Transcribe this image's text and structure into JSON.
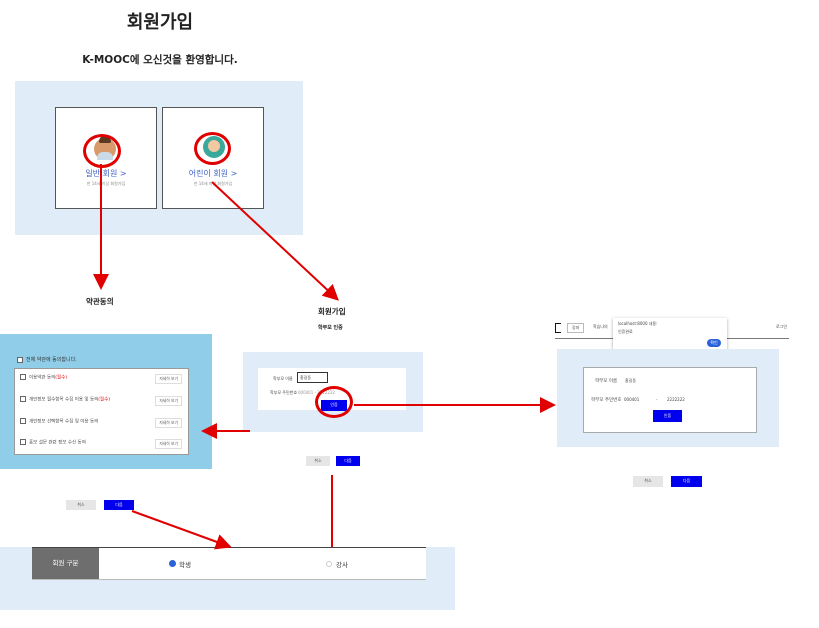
{
  "title": "회원가입",
  "welcome": "K-MOOC에 오신것을 환영합니다.",
  "cards": {
    "general": {
      "label": "일반 회원 >",
      "sub": "만 14세 이상 회원가입"
    },
    "child": {
      "label": "어린이 회원 >",
      "sub": "만 14세 미만 회원가입"
    }
  },
  "terms_heading": "약관동의",
  "terms": {
    "all": "전체 약관에 동의합니다.",
    "items": [
      {
        "text": "이용약관 동의",
        "req": "(필수)",
        "detail": "자세히 보기"
      },
      {
        "text": "개인정보 필수항목 수집 이용 및 동의",
        "req": "(필수)",
        "detail": "자세히 보기"
      },
      {
        "text": "개인정보 선택항목 수집 및 이용 동의",
        "req": "",
        "detail": "자세히 보기"
      },
      {
        "text": "홍보 설문 관련 정보 수신 동의",
        "req": "",
        "detail": "자세히 보기"
      }
    ]
  },
  "signup2": {
    "title": "회원가입",
    "subtitle": "학부모 인증"
  },
  "auth_form": {
    "name_label": "학부모 이름",
    "name_value": "홍길동",
    "rrn_label": "학부모 주민번호",
    "rrn_value": "000401  -  2222222",
    "verify": "인증"
  },
  "buttons": {
    "cancel": "취소",
    "next": "다음"
  },
  "screenshot": {
    "nav_items": [
      "강좌",
      "학습나의"
    ],
    "popup_title": "localhost:8000 내용:",
    "popup_msg": "인증완료",
    "popup_ok": "확인",
    "login": "로그인",
    "name_label": "학부모 이름",
    "name_value": "홍길동",
    "rrn_label": "학부모 주민번호",
    "rrn_front": "000401",
    "rrn_back": "2222222",
    "verify": "인증"
  },
  "role": {
    "head": "회원 구분",
    "student": "학생",
    "teacher": "강사"
  },
  "colors": {
    "accent_blue": "#0000ee",
    "highlight_red": "#e00000",
    "panel_bg": "#e0ecf8",
    "terms_bg": "#8fcde8"
  }
}
